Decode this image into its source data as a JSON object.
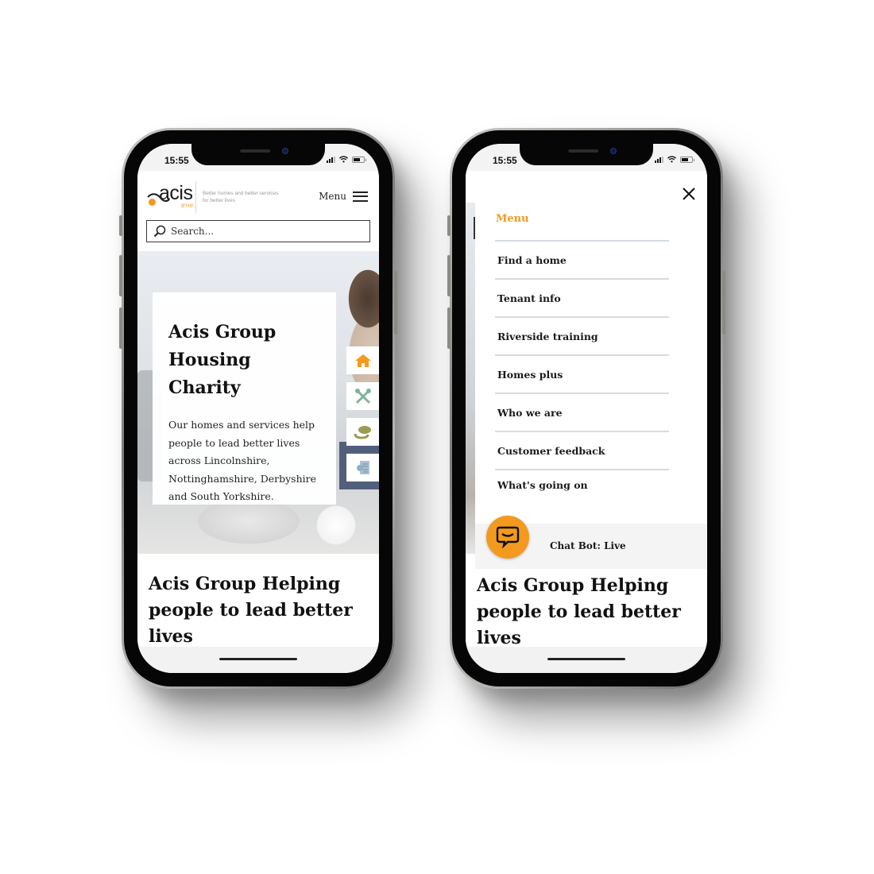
{
  "phones": [
    {
      "id": "home",
      "status": {
        "time": "15:55"
      },
      "header": {
        "logo_word": "acis",
        "logo_sub": "group",
        "tagline": "Better homes and better services for better lives",
        "menu_label": "Menu"
      },
      "search": {
        "placeholder": "Search..."
      },
      "hero": {
        "title": "Acis Group Housing Charity",
        "body": "Our homes and services help people to lead better lives across Lincolnshire, Nottinghamshire, Derbyshire and South Yorkshire."
      },
      "quick_links": [
        {
          "icon": "home-icon",
          "color": "#f39a1e"
        },
        {
          "icon": "tools-icon",
          "color": "#7fb39a"
        },
        {
          "icon": "coins-icon",
          "color": "#9b9a52"
        },
        {
          "icon": "certificate-icon",
          "color": "#8fb0c6"
        }
      ],
      "section_heading": "Acis Group Helping people to lead better lives"
    },
    {
      "id": "menu",
      "status": {
        "time": "15:55"
      },
      "menu": {
        "title": "Menu",
        "items": [
          "Find a home",
          "Tenant info",
          "Riverside training",
          "Homes plus",
          "Who we are",
          "Customer feedback",
          "What's going on"
        ]
      },
      "chatbot": {
        "label": "Chat Bot: Live"
      },
      "section_heading": "Acis Group Helping people to lead better lives"
    }
  ],
  "colors": {
    "accent": "#f39a1e",
    "text": "#111111",
    "divider": "#d5dbe1"
  }
}
